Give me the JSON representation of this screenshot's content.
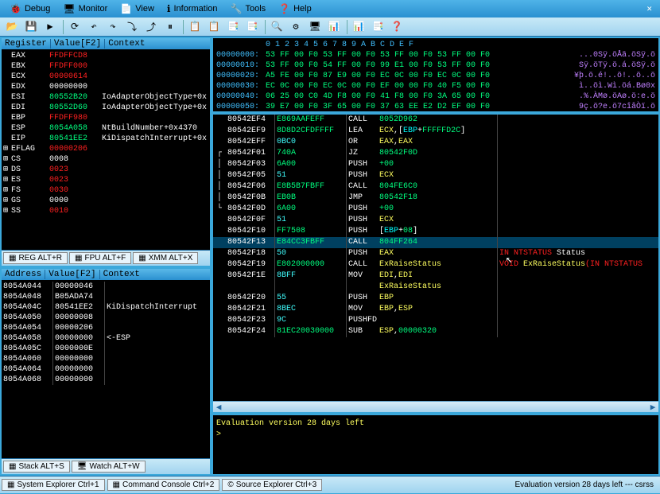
{
  "menu": {
    "items": [
      {
        "icon": "🐞",
        "label": "Debug"
      },
      {
        "icon": "🖥",
        "label": "Monitor"
      },
      {
        "icon": "📄",
        "label": "View"
      },
      {
        "icon": "ℹ",
        "label": "Information"
      },
      {
        "icon": "🔧",
        "label": "Tools"
      },
      {
        "icon": "❓",
        "label": "Help"
      }
    ],
    "close": "✕"
  },
  "toolbar": {
    "buttons": [
      "📂",
      "💾",
      "▶",
      "⟳",
      "↶",
      "↷",
      "⤵",
      "⤴",
      "⏸",
      "📋",
      "📋",
      "📑",
      "📑",
      "🔍",
      "⚙",
      "🖥",
      "📊",
      "📊",
      "📑",
      "❓"
    ]
  },
  "registers": {
    "headers": [
      "Register",
      "Value[F2]",
      "Context"
    ],
    "rows": [
      {
        "e": "",
        "n": "EAX",
        "v": "FFDFFCD8",
        "c": "",
        "vc": "c-red"
      },
      {
        "e": "",
        "n": "EBX",
        "v": "FFDFF000",
        "c": "",
        "vc": "c-red"
      },
      {
        "e": "",
        "n": "ECX",
        "v": "00000614",
        "c": "",
        "vc": "c-red"
      },
      {
        "e": "",
        "n": "EDX",
        "v": "00000000",
        "c": "",
        "vc": "c-white"
      },
      {
        "e": "",
        "n": "ESI",
        "v": "80552B20",
        "c": "IoAdapterObjectType+0x",
        "vc": "c-green"
      },
      {
        "e": "",
        "n": "EDI",
        "v": "80552D60",
        "c": "IoAdapterObjectType+0x",
        "vc": "c-green"
      },
      {
        "e": "",
        "n": "EBP",
        "v": "FFDFF980",
        "c": "",
        "vc": "c-red"
      },
      {
        "e": "",
        "n": "ESP",
        "v": "8054A058",
        "c": "NtBuildNumber+0x4370",
        "vc": "c-green"
      },
      {
        "e": "",
        "n": "EIP",
        "v": "80541EE2",
        "c": "KiDispatchInterrupt+0x",
        "vc": "c-green"
      },
      {
        "e": "⊞",
        "n": "EFLAG",
        "v": "00000206",
        "c": "",
        "vc": "c-red"
      },
      {
        "e": "⊞",
        "n": "CS",
        "v": "0008",
        "c": "",
        "vc": "c-white"
      },
      {
        "e": "⊞",
        "n": "DS",
        "v": "0023",
        "c": "",
        "vc": "c-red"
      },
      {
        "e": "⊞",
        "n": "ES",
        "v": "0023",
        "c": "",
        "vc": "c-red"
      },
      {
        "e": "⊞",
        "n": "FS",
        "v": "0030",
        "c": "",
        "vc": "c-red"
      },
      {
        "e": "⊞",
        "n": "GS",
        "v": "0000",
        "c": "",
        "vc": "c-white"
      },
      {
        "e": "⊞",
        "n": "SS",
        "v": "0010",
        "c": "",
        "vc": "c-red"
      }
    ],
    "tabs": [
      {
        "icon": "▦",
        "label": "REG ALT+R"
      },
      {
        "icon": "▦",
        "label": "FPU ALT+F"
      },
      {
        "icon": "▦",
        "label": "XMM ALT+X"
      }
    ]
  },
  "stack": {
    "headers": [
      "Address",
      "Value[F2]",
      "Context"
    ],
    "rows": [
      {
        "a": "8054A044",
        "v": "00000046",
        "c": ""
      },
      {
        "a": "8054A048",
        "v": "B05ADA74",
        "c": ""
      },
      {
        "a": "8054A04C",
        "v": "80541EE2",
        "c": "KiDispatchInterrupt"
      },
      {
        "a": "8054A050",
        "v": "00000008",
        "c": ""
      },
      {
        "a": "8054A054",
        "v": "00000206",
        "c": ""
      },
      {
        "a": "8054A058",
        "v": "00000000",
        "c": "<-ESP"
      },
      {
        "a": "8054A05C",
        "v": "0000000E",
        "c": ""
      },
      {
        "a": "8054A060",
        "v": "00000000",
        "c": ""
      },
      {
        "a": "8054A064",
        "v": "00000000",
        "c": ""
      },
      {
        "a": "8054A068",
        "v": "00000000",
        "c": ""
      }
    ],
    "tabs": [
      {
        "icon": "▦",
        "label": "Stack ALT+S"
      },
      {
        "icon": "🖥",
        "label": "Watch ALT+W"
      }
    ]
  },
  "hexdump": {
    "ruler": "0  1  2  3  4  5  6  7  8  9  A  B  C  D  E  F",
    "rows": [
      {
        "off": "00000000:",
        "b": "53 FF 00 F0 53 FF 00 F0 53 FF 00 F0 53 FF 00 F0",
        "a": "...0Sÿ.öÅä.öSÿ.ö"
      },
      {
        "off": "00000010:",
        "b": "53 FF 00 F0 54 FF 00 F0 99 E1 00 F0 53 FF 00 F0",
        "a": "Sÿ.öTÿ.ö.á.öSÿ.ö"
      },
      {
        "off": "00000020:",
        "b": "A5 FE 00 F0 87 E9 00 F0 EC 0C 00 F0 EC 0C 00 F0",
        "a": "¥þ.ö.é!..ö!..ö..ö"
      },
      {
        "off": "00000030:",
        "b": "EC 0C 00 F0 EC 0C 00 F0 EF 00 00 F0 40 F5 00 F0",
        "a": "ì..öì.Wì.öá.Bø0x"
      },
      {
        "off": "00000040:",
        "b": "06 25 00 C0 4D F8 00 F0 41 F8 00 F0 3A 65 00 F0",
        "a": ".%.ÀMø.öAø.ö:e.ö"
      },
      {
        "off": "00000050:",
        "b": "39 E7 00 F0 3F 65 00 F0 37 63 EE E2 D2 EF 00 F0",
        "a": "9ç.ö?e.ö7cîâÒï.ö"
      }
    ]
  },
  "disasm": {
    "rows": [
      {
        "g": "",
        "a": "80542EF4",
        "b": "E869AAFEFF",
        "bc": "c-green",
        "m": "CALL",
        "op": [
          {
            "t": "8052D962",
            "c": "c-green"
          }
        ],
        "info": ""
      },
      {
        "g": "",
        "a": "80542EF9",
        "b": "8D8D2CFDFFFF",
        "bc": "c-green",
        "m": "LEA",
        "op": [
          {
            "t": "ECX",
            "c": "c-yellow"
          },
          {
            "t": ",[",
            "c": "c-white"
          },
          {
            "t": "EBP",
            "c": "c-cyan"
          },
          {
            "t": "+",
            "c": "c-white"
          },
          {
            "t": "FFFFFD2C",
            "c": "c-green"
          },
          {
            "t": "]",
            "c": "c-white"
          }
        ],
        "info": ""
      },
      {
        "g": "",
        "a": "80542EFF",
        "b": "0BC0",
        "bc": "c-aqua",
        "m": "OR",
        "op": [
          {
            "t": "EAX",
            "c": "c-yellow"
          },
          {
            "t": ",",
            "c": "c-white"
          },
          {
            "t": "EAX",
            "c": "c-yellow"
          }
        ],
        "info": ""
      },
      {
        "g": "┌",
        "a": "80542F01",
        "b": "740A",
        "bc": "c-green",
        "m": "JZ",
        "op": [
          {
            "t": "80542F0D",
            "c": "c-green"
          }
        ],
        "info": ""
      },
      {
        "g": "│",
        "a": "80542F03",
        "b": "6A00",
        "bc": "c-green",
        "m": "PUSH",
        "op": [
          {
            "t": "+00",
            "c": "c-green"
          }
        ],
        "info": ""
      },
      {
        "g": "│",
        "a": "80542F05",
        "b": "51",
        "bc": "c-aqua",
        "m": "PUSH",
        "op": [
          {
            "t": "ECX",
            "c": "c-yellow"
          }
        ],
        "info": ""
      },
      {
        "g": "│",
        "a": "80542F06",
        "b": "E8B5B7FBFF",
        "bc": "c-green",
        "m": "CALL",
        "op": [
          {
            "t": "804FE6C0",
            "c": "c-green"
          }
        ],
        "info": ""
      },
      {
        "g": "│",
        "a": "80542F0B",
        "b": "EB0B",
        "bc": "c-green",
        "m": "JMP",
        "op": [
          {
            "t": "80542F18",
            "c": "c-green"
          }
        ],
        "info": ""
      },
      {
        "g": "└",
        "a": "80542F0D",
        "b": "6A00",
        "bc": "c-green",
        "m": "PUSH",
        "op": [
          {
            "t": "+00",
            "c": "c-green"
          }
        ],
        "info": ""
      },
      {
        "g": "",
        "a": "80542F0F",
        "b": "51",
        "bc": "c-aqua",
        "m": "PUSH",
        "op": [
          {
            "t": "ECX",
            "c": "c-yellow"
          }
        ],
        "info": ""
      },
      {
        "g": "",
        "a": "80542F10",
        "b": "FF7508",
        "bc": "c-green",
        "m": "PUSH",
        "op": [
          {
            "t": "[",
            "c": "c-white"
          },
          {
            "t": "EBP",
            "c": "c-cyan"
          },
          {
            "t": "+",
            "c": "c-white"
          },
          {
            "t": "08",
            "c": "c-green"
          },
          {
            "t": "]",
            "c": "c-white"
          }
        ],
        "info": ""
      },
      {
        "g": "",
        "a": "80542F13",
        "b": "E84CC3FBFF",
        "bc": "c-green",
        "m": "CALL",
        "op": [
          {
            "t": "804FF264",
            "c": "c-green"
          }
        ],
        "info": "",
        "hl": true
      },
      {
        "g": "",
        "a": "80542F18",
        "b": "50",
        "bc": "c-aqua",
        "m": "PUSH",
        "op": [
          {
            "t": "EAX",
            "c": "c-yellow"
          }
        ],
        "info": [
          {
            "t": "IN NTSTATUS",
            "c": "c-red"
          },
          {
            "t": " Status",
            "c": "c-white"
          }
        ]
      },
      {
        "g": "",
        "a": "80542F19",
        "b": "E802000000",
        "bc": "c-green",
        "m": "CALL",
        "op": [
          {
            "t": "ExRaiseStatus",
            "c": "c-yellow"
          }
        ],
        "info": [
          {
            "t": "VOID ",
            "c": "c-red"
          },
          {
            "t": "ExRaiseStatus",
            "c": "c-yellow"
          },
          {
            "t": "(IN NTSTATUS ",
            "c": "c-red"
          }
        ]
      },
      {
        "g": "",
        "a": "80542F1E",
        "b": "8BFF",
        "bc": "c-aqua",
        "m": "MOV",
        "op": [
          {
            "t": "EDI",
            "c": "c-yellow"
          },
          {
            "t": ",",
            "c": "c-white"
          },
          {
            "t": "EDI",
            "c": "c-yellow"
          }
        ],
        "info": ""
      },
      {
        "g": "",
        "a": "",
        "b": "",
        "bc": "",
        "m": "",
        "op": [
          {
            "t": "ExRaiseStatus",
            "c": "c-yellow"
          }
        ],
        "info": ""
      },
      {
        "g": "",
        "a": "80542F20",
        "b": "55",
        "bc": "c-aqua",
        "m": "PUSH",
        "op": [
          {
            "t": "EBP",
            "c": "c-yellow"
          }
        ],
        "info": ""
      },
      {
        "g": "",
        "a": "80542F21",
        "b": "8BEC",
        "bc": "c-aqua",
        "m": "MOV",
        "op": [
          {
            "t": "EBP",
            "c": "c-yellow"
          },
          {
            "t": ",",
            "c": "c-white"
          },
          {
            "t": "ESP",
            "c": "c-yellow"
          }
        ],
        "info": ""
      },
      {
        "g": "",
        "a": "80542F23",
        "b": "9C",
        "bc": "c-aqua",
        "m": "PUSHFD",
        "op": [],
        "info": ""
      },
      {
        "g": "",
        "a": "80542F24",
        "b": "81EC20030000",
        "bc": "c-green",
        "m": "SUB",
        "op": [
          {
            "t": "ESP",
            "c": "c-yellow"
          },
          {
            "t": ",",
            "c": "c-white"
          },
          {
            "t": "00000320",
            "c": "c-green"
          }
        ],
        "info": ""
      }
    ]
  },
  "console": {
    "line1": "Evaluation version 28 days left",
    "prompt": ">"
  },
  "statusbar": {
    "buttons": [
      {
        "icon": "▦",
        "label": "System Explorer Ctrl+1"
      },
      {
        "icon": "▦",
        "label": "Command Console Ctrl+2"
      },
      {
        "icon": "©",
        "label": "Source Explorer Ctrl+3"
      }
    ],
    "status": "Evaluation version 28 days left --- csrss"
  }
}
